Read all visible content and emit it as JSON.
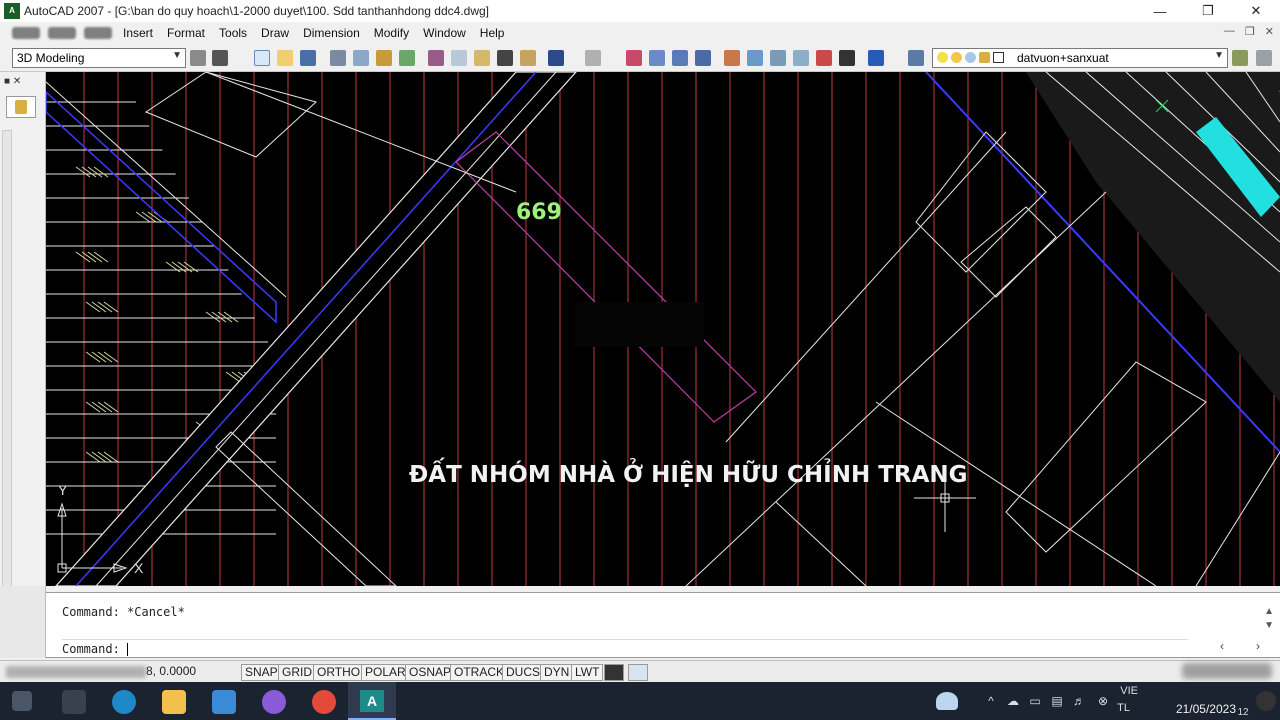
{
  "window": {
    "title": "AutoCAD 2007 - [G:\\ban do quy hoach\\1-2000 duyet\\100. Sdd tanthanhdong ddc4.dwg]",
    "app_icon_label": "A"
  },
  "menubar": {
    "items": [
      "Insert",
      "Format",
      "Tools",
      "Draw",
      "Dimension",
      "Modify",
      "Window",
      "Help"
    ]
  },
  "toolbar": {
    "workspace": "3D Modeling",
    "layer": "datvuon+sanxuat"
  },
  "drawing": {
    "parcel_number": "669",
    "zone_label": "ĐẤT NHÓM NHÀ Ở HIỆN HỮU CHỈNH TRANG",
    "ucs_x": "X",
    "ucs_y": "Y"
  },
  "command": {
    "history": "Command: *Cancel*",
    "prompt": "Command:"
  },
  "statusbar": {
    "coordinates": "8, 0.0000",
    "toggles": [
      "SNAP",
      "GRID",
      "ORTHO",
      "POLAR",
      "OSNAP",
      "OTRACK",
      "DUCS",
      "DYN",
      "LWT"
    ]
  },
  "taskbar": {
    "language": "VIE",
    "language2": "TL",
    "date": "21/05/2023"
  }
}
